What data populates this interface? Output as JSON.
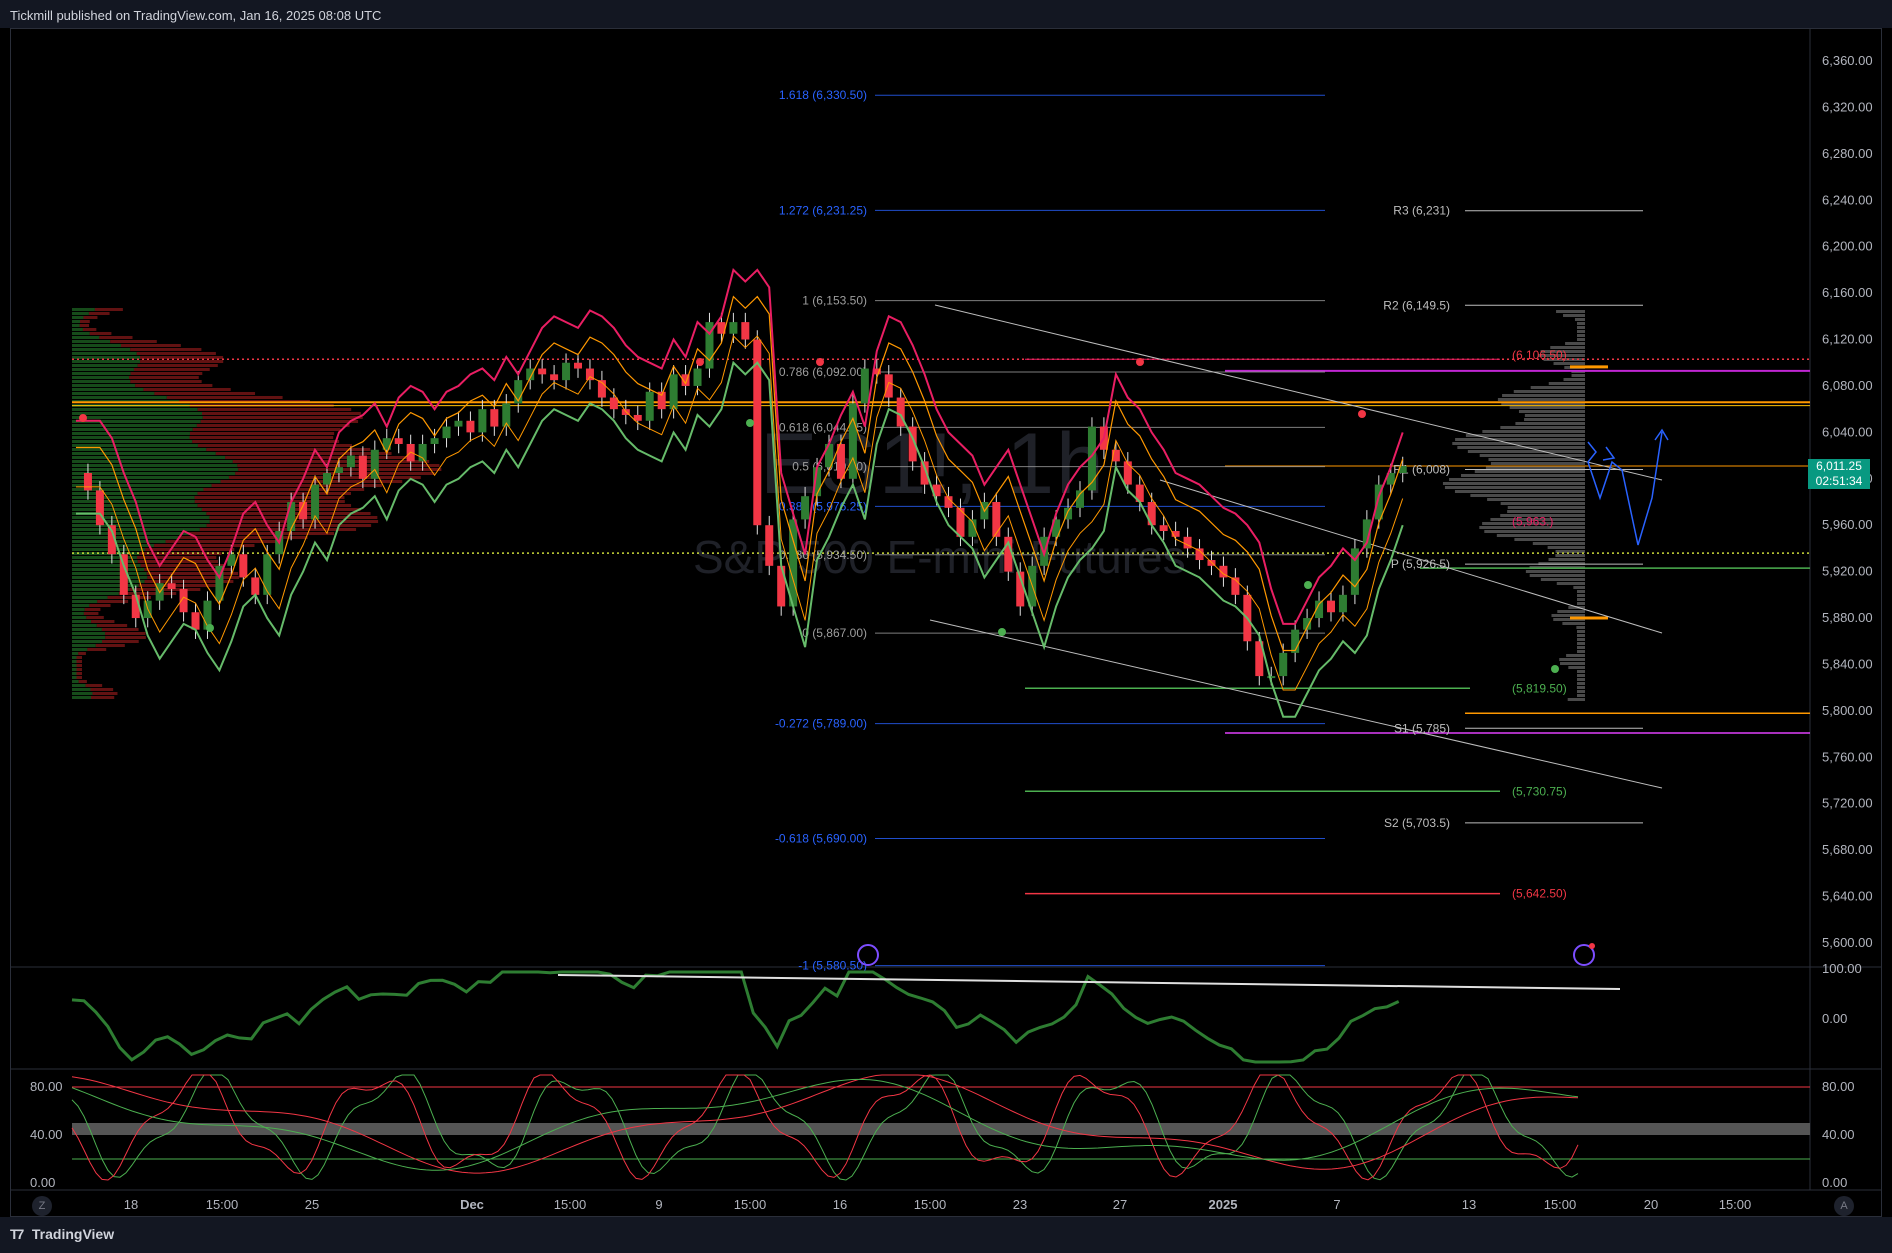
{
  "header": {
    "publisher_text": "Tickmill published on TradingView.com, Jan 16, 2025 08:08 UTC"
  },
  "branding": {
    "logo_text": "TradingView"
  },
  "watermark": {
    "symbol": "ES1!, 1h",
    "description": "S&P 500 E-mini Futures"
  },
  "current_price": {
    "value": "6,011.25",
    "countdown": "02:51:34",
    "color": "#089981"
  },
  "colors": {
    "bull": "#2e7d32",
    "bear": "#f23645",
    "magenta": "#e91e63",
    "orange": "#ff9800",
    "green_line": "#66bb6a",
    "fib_blue": "#2962ff",
    "purple": "#e040fb"
  },
  "chart_data": [
    {
      "type": "line",
      "title": "",
      "description_shown": "main price pane with candles, Fibonacci retracement, pivot levels and volume profile",
      "price_axis_ticks": [
        "6,360.00",
        "6,320.00",
        "6,280.00",
        "6,240.00",
        "6,200.00",
        "6,160.00",
        "6,120.00",
        "6,080.00",
        "6,040.00",
        "6,000.00",
        "5,960.00",
        "5,920.00",
        "5,880.00",
        "5,840.00",
        "5,800.00",
        "5,760.00",
        "5,720.00",
        "5,680.00",
        "5,640.00",
        "5,600.00"
      ],
      "ylim": [
        5580,
        6380
      ],
      "time_axis_ticks": [
        "18",
        "15:00",
        "25",
        "Dec",
        "15:00",
        "9",
        "15:00",
        "16",
        "15:00",
        "23",
        "27",
        "2025",
        "7",
        "13",
        "15:00",
        "20",
        "15:00"
      ],
      "fib_levels": [
        {
          "label": "1.618 (6,330.50)",
          "value": 6330.5
        },
        {
          "label": "1.272 (6,231.25)",
          "value": 6231.25
        },
        {
          "label": "1 (6,153.50)",
          "value": 6153.5
        },
        {
          "label": "0.786 (6,092.00)",
          "value": 6092.0
        },
        {
          "label": "0.618 (6,044.25)",
          "value": 6044.25
        },
        {
          "label": "0.5 (6,010.50)",
          "value": 6010.5
        },
        {
          "label": "0.382 (5,976.25)",
          "value": 5976.25
        },
        {
          "label": "0.236 (5,934.50)",
          "value": 5934.5
        },
        {
          "label": "0 (5,867.00)",
          "value": 5867.0
        },
        {
          "label": "-0.272 (5,789.00)",
          "value": 5789.0
        },
        {
          "label": "-0.618 (5,690.00)",
          "value": 5690.0
        },
        {
          "label": "-1 (5,580.50)",
          "value": 5580.5
        }
      ],
      "pivot_levels": [
        {
          "label": "R3 (6,231)",
          "value": 6231
        },
        {
          "label": "R2 (6,149.5)",
          "value": 6149.5
        },
        {
          "label": "R1 (6,008)",
          "value": 6008
        },
        {
          "label": "P (5,926.5)",
          "value": 5926.5
        },
        {
          "label": "S1 (5,785)",
          "value": 5785
        },
        {
          "label": "S2 (5,703.5)",
          "value": 5703.5
        }
      ],
      "colored_levels": [
        {
          "label": "(6,106.50)",
          "value": 6106.5,
          "color": "#f23645"
        },
        {
          "label": "(5,963.)",
          "value": 5963,
          "color": "#e91e63"
        },
        {
          "label": "(5,819.50)",
          "value": 5819.5,
          "color": "#4caf50"
        },
        {
          "label": "(5,730.75)",
          "value": 5730.75,
          "color": "#4caf50"
        },
        {
          "label": "(5,642.50)",
          "value": 5642.5,
          "color": "#f23645"
        }
      ],
      "close_series": {
        "x_index": [
          0,
          10,
          20,
          30,
          40,
          50,
          60,
          70,
          80,
          90,
          100,
          110,
          120,
          130,
          140,
          150,
          160,
          170,
          180,
          190,
          200,
          210,
          220,
          230,
          240,
          250,
          260,
          270,
          280,
          290,
          300,
          310,
          320,
          330,
          340,
          350,
          360,
          370,
          380,
          390,
          400,
          410,
          420,
          430,
          440,
          450,
          460,
          470,
          480,
          490,
          500,
          510,
          520,
          530,
          540,
          550,
          560,
          570,
          580,
          590,
          600,
          610,
          620,
          630,
          640,
          650,
          660,
          670,
          680,
          690,
          700,
          710,
          720,
          730,
          740,
          750,
          760,
          770,
          780,
          790,
          800,
          810,
          820,
          830,
          840,
          850,
          860,
          870,
          880,
          890,
          900,
          910,
          920,
          930,
          940,
          950,
          960,
          970,
          980,
          990,
          1000,
          1010,
          1020,
          1030,
          1040,
          1050,
          1060,
          1070,
          1080,
          1090,
          1100,
          1110,
          1120,
          1130,
          1140,
          1150,
          1160,
          1170,
          1180,
          1190,
          1200,
          1210,
          1220,
          1230,
          1240,
          1250,
          1260
        ],
        "values": [
          6005,
          5990,
          5960,
          5935,
          5900,
          5880,
          5895,
          5910,
          5905,
          5885,
          5870,
          5895,
          5925,
          5935,
          5915,
          5900,
          5935,
          5955,
          5980,
          5965,
          5995,
          6005,
          6010,
          6020,
          6000,
          6025,
          6035,
          6030,
          6015,
          6030,
          6035,
          6045,
          6050,
          6040,
          6060,
          6045,
          6065,
          6085,
          6095,
          6090,
          6085,
          6100,
          6095,
          6085,
          6070,
          6060,
          6055,
          6050,
          6075,
          6060,
          6090,
          6080,
          6095,
          6135,
          6125,
          6135,
          6120,
          5960,
          5925,
          5890,
          5965,
          5985,
          6010,
          6030,
          6000,
          6065,
          6095,
          6090,
          6070,
          6045,
          6015,
          5995,
          5985,
          5975,
          5950,
          5965,
          5980,
          5950,
          5920,
          5890,
          5925,
          5950,
          5965,
          5975,
          5990,
          6045,
          6025,
          6015,
          5995,
          5980,
          5960,
          5955,
          5950,
          5940,
          5930,
          5925,
          5915,
          5900,
          5860,
          5830,
          5830,
          5850,
          5870,
          5880,
          5895,
          5885,
          5900,
          5940,
          5965,
          5995,
          6005,
          6011
        ]
      }
    },
    {
      "type": "line",
      "title": "",
      "description_shown": "oscillator pane 1",
      "axis_ticks": [
        "100.00",
        "0.00"
      ],
      "ylim": [
        -60,
        100
      ]
    },
    {
      "type": "line",
      "title": "",
      "description_shown": "oscillator pane 2 (stochastic)",
      "axis_ticks": [
        "80.00",
        "40.00",
        "0.00"
      ],
      "ylim": [
        0,
        100
      ],
      "left_axis_ticks": [
        "80.00",
        "40.00",
        "0.00"
      ]
    }
  ]
}
